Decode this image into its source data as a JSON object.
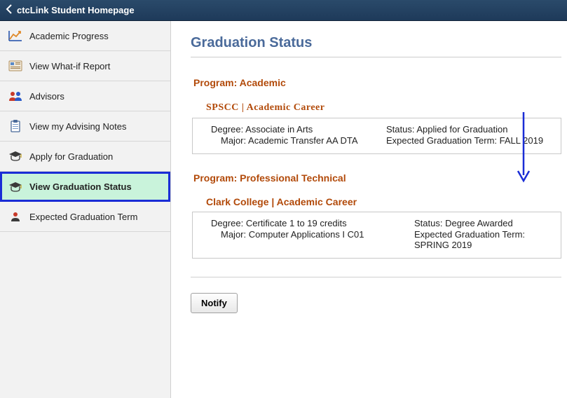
{
  "header": {
    "title": "ctcLink Student Homepage"
  },
  "sidebar": {
    "items": [
      {
        "label": "Academic Progress"
      },
      {
        "label": "View What-if Report"
      },
      {
        "label": "Advisors"
      },
      {
        "label": "View my Advising Notes"
      },
      {
        "label": "Apply for Graduation"
      },
      {
        "label": "View Graduation Status"
      },
      {
        "label": "Expected Graduation Term"
      }
    ]
  },
  "main": {
    "page_title": "Graduation Status",
    "programs": [
      {
        "program_label": "Program: Academic",
        "career_label": "SPSCC | Academic Career",
        "degree_label": "Degree:",
        "degree_value": "Associate in Arts",
        "major_label": "Major:",
        "major_value": "Academic Transfer AA DTA",
        "status_label": "Status:",
        "status_value": "Applied for Graduation",
        "term_label": "Expected Graduation Term:",
        "term_value": "FALL 2019"
      },
      {
        "program_label": "Program: Professional Technical",
        "career_label": "Clark College | Academic Career",
        "degree_label": "Degree:",
        "degree_value": "Certificate 1 to 19 credits",
        "major_label": "Major:",
        "major_value": "Computer Applications I C01",
        "status_label": "Status:",
        "status_value": "Degree Awarded",
        "term_label": "Expected Graduation Term:",
        "term_value": "SPRING 2019"
      }
    ],
    "notify_label": "Notify"
  }
}
